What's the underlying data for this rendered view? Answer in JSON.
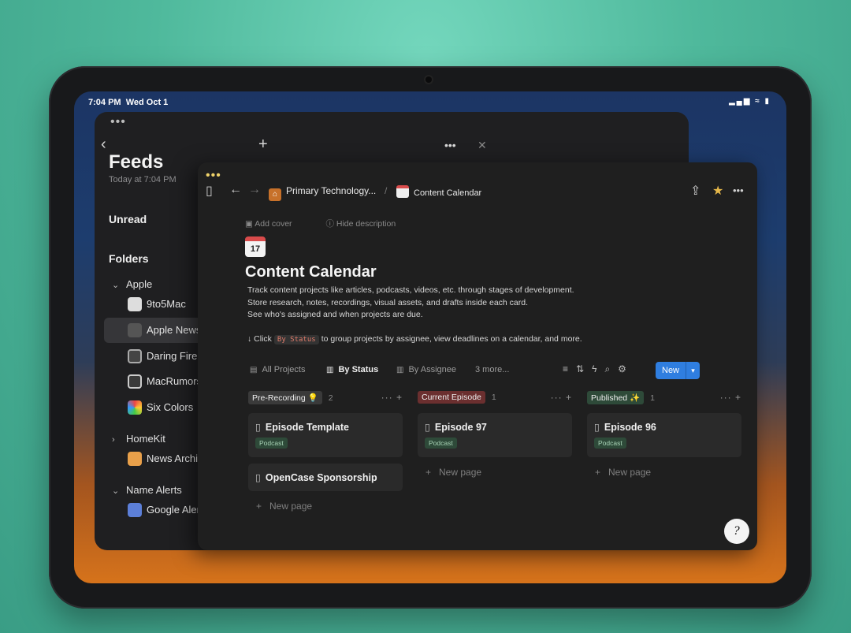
{
  "status": {
    "time": "7:04 PM",
    "date": "Wed Oct 1",
    "icons": "▂▄▆ ≈ ▮"
  },
  "feeds": {
    "title": "Feeds",
    "subtitle": "Today at 7:04 PM",
    "unread": "Unread",
    "folders": "Folders",
    "groups": [
      {
        "label": "Apple",
        "items": [
          "9to5Mac",
          "Apple Newsroom",
          "Daring Fireball",
          "MacRumors",
          "Six Colors"
        ]
      },
      {
        "label": "HomeKit",
        "items": [
          "News Archive"
        ]
      },
      {
        "label": "Name Alerts",
        "items": [
          "Google Alerts"
        ]
      }
    ]
  },
  "notion": {
    "breadcrumb_parent": "Primary Technology...",
    "breadcrumb_sep": "/",
    "breadcrumb_page": "Content Calendar",
    "add_cover": "Add cover",
    "hide_description": "Hide description",
    "calendar_day": "17",
    "title": "Content Calendar",
    "desc_lines": [
      "Track content projects like articles, podcasts, videos, etc. through stages of development.",
      "Store research, notes, recordings, visual assets, and drafts inside each card.",
      "See who's assigned and when projects are due."
    ],
    "hint_prefix": "↓ Click",
    "hint_code": "By Status",
    "hint_suffix": "to group projects by assignee, view deadlines on a calendar, and more.",
    "views": {
      "all": "All Projects",
      "status": "By Status",
      "assignee": "By Assignee",
      "more": "3 more..."
    },
    "new_button": "New",
    "columns": [
      {
        "name": "Pre-Recording 💡",
        "count": "2",
        "color": "#3a3a3a",
        "cards": [
          {
            "title": "Episode Template",
            "tag": "Podcast"
          },
          {
            "title": "OpenCase Sponsorship",
            "tag": ""
          }
        ]
      },
      {
        "name": "Current Episode",
        "count": "1",
        "color": "#6b2f2f",
        "cards": [
          {
            "title": "Episode 97",
            "tag": "Podcast"
          }
        ]
      },
      {
        "name": "Published ✨",
        "count": "1",
        "color": "#2e4a39",
        "cards": [
          {
            "title": "Episode 96",
            "tag": "Podcast"
          }
        ]
      }
    ],
    "new_page": "New page"
  }
}
